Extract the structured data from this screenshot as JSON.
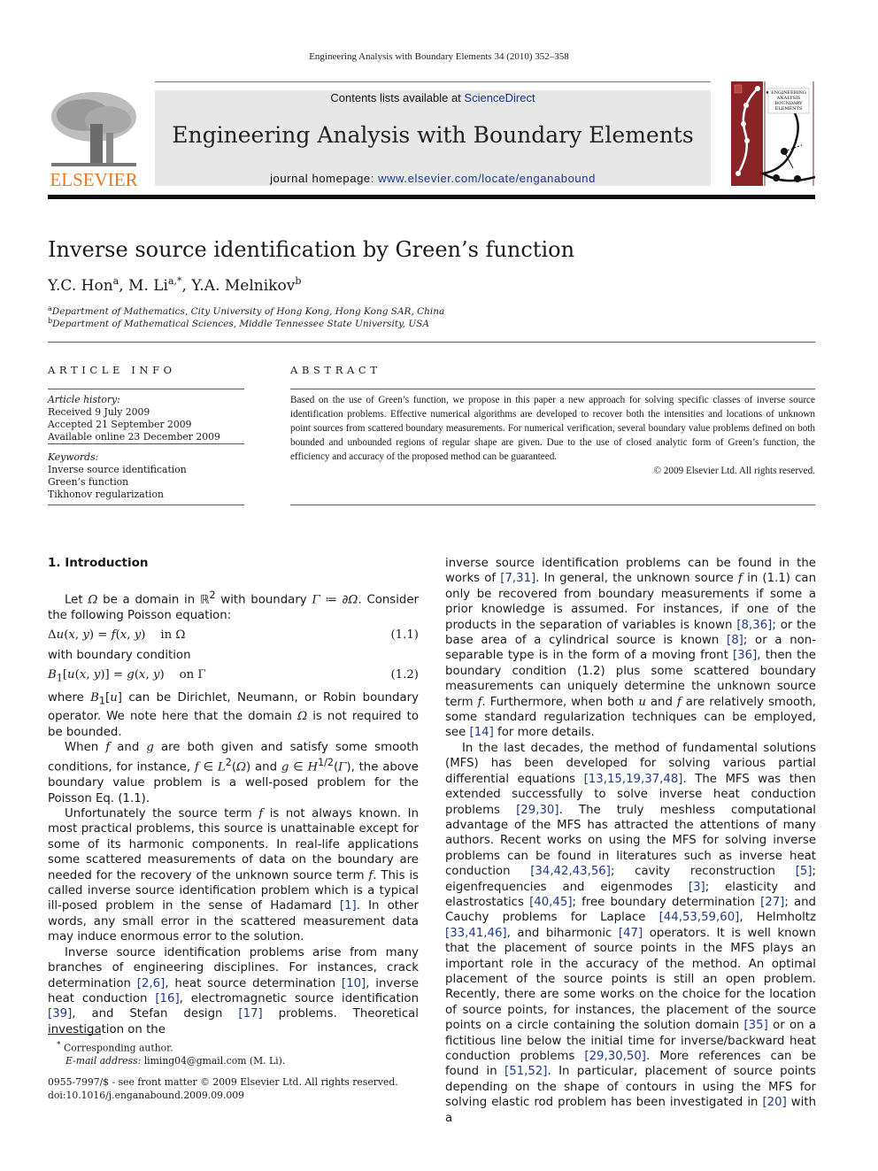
{
  "running_header": "Engineering Analysis with Boundary Elements 34 (2010) 352–358",
  "masthead": {
    "publisher_logo_text": "ELSEVIER",
    "contents_prefix": "Contents lists available at ",
    "contents_link": "ScienceDirect",
    "journal_title": "Engineering Analysis with Boundary Elements",
    "homepage_prefix": "journal homepage: ",
    "homepage_link": "www.elsevier.com/locate/enganabound",
    "cover_text": [
      "ENGINEERING",
      "ANALYSIS",
      "BOUNDARY",
      "ELEMENTS"
    ],
    "colors": {
      "cover_red": "#8b2427",
      "publisher_orange": "#e87722",
      "link_blue": "#1f3a8a",
      "banner_gray": "#e6e6e6"
    }
  },
  "article": {
    "title": "Inverse source identification by Green’s function",
    "authors": [
      {
        "name": "Y.C. Hon",
        "sup": "a"
      },
      {
        "name": "M. Li",
        "sup": "a,*"
      },
      {
        "name": "Y.A. Melnikov",
        "sup": "b"
      }
    ],
    "affiliations": [
      {
        "sup": "a",
        "text": "Department of Mathematics, City University of Hong Kong, Hong Kong SAR, China"
      },
      {
        "sup": "b",
        "text": "Department of Mathematical Sciences, Middle Tennessee State University, USA"
      }
    ]
  },
  "article_info": {
    "heading": "ARTICLE INFO",
    "history_label": "Article history:",
    "history": [
      "Received 9 July 2009",
      "Accepted 21 September 2009",
      "Available online 23 December 2009"
    ],
    "keywords_label": "Keywords:",
    "keywords": [
      "Inverse source identification",
      "Green’s function",
      "Tikhonov regularization"
    ]
  },
  "abstract": {
    "heading": "ABSTRACT",
    "text": "Based on the use of Green’s function, we propose in this paper a new approach for solving specific classes of inverse source identification problems. Effective numerical algorithms are developed to recover both the intensities and locations of unknown point sources from scattered boundary measurements. For numerical verification, several boundary value problems defined on both bounded and unbounded regions of regular shape are given. Due to the use of closed analytic form of Green’s function, the efficiency and accuracy of the proposed method can be guaranteed.",
    "copyright": "© 2009 Elsevier Ltd. All rights reserved."
  },
  "section1": {
    "heading": "1.  Introduction",
    "eq1_label": "(1.1)",
    "eq2_label": "(1.2)",
    "eq1_tail": "in Ω",
    "eq2_tail": "on Γ",
    "with_bc": "with boundary condition"
  },
  "footnote": {
    "corresponding": "Corresponding author.",
    "email_label": "E-mail address:",
    "email": "liming04@gmail.com (M. Li)."
  },
  "front_matter": {
    "issn_line": "0955-7997/$ - see front matter © 2009 Elsevier Ltd. All rights reserved.",
    "doi": "doi:10.1016/j.enganabound.2009.09.009"
  }
}
